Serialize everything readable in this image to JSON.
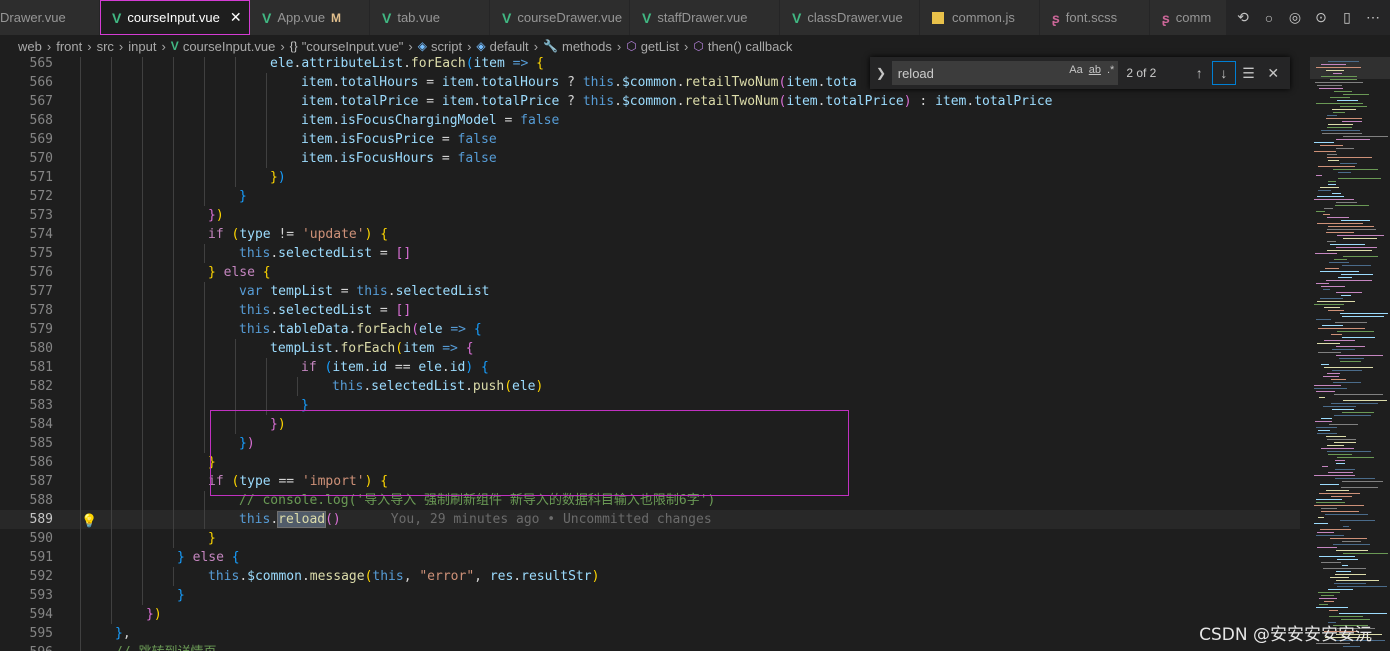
{
  "tabs": [
    {
      "label": "Drawer.vue",
      "icon": "vue-icon",
      "active": false
    },
    {
      "label": "courseInput.vue",
      "icon": "vue-icon",
      "active": true
    },
    {
      "label": "App.vue",
      "icon": "vue-icon",
      "active": false,
      "modified": "M"
    },
    {
      "label": "tab.vue",
      "icon": "vue-icon",
      "active": false
    },
    {
      "label": "courseDrawer.vue",
      "icon": "vue-icon",
      "active": false
    },
    {
      "label": "staffDrawer.vue",
      "icon": "vue-icon",
      "active": false
    },
    {
      "label": "classDrawer.vue",
      "icon": "vue-icon",
      "active": false
    },
    {
      "label": "common.js",
      "icon": "js-icon",
      "active": false
    },
    {
      "label": "font.scss",
      "icon": "sass-icon",
      "active": false
    },
    {
      "label": "comm",
      "icon": "sass-icon",
      "active": false
    }
  ],
  "tab_close": "✕",
  "breadcrumb": {
    "items": [
      "web",
      "front",
      "src",
      "input",
      "courseInput.vue",
      "\"courseInput.vue\"",
      "script",
      "default",
      "methods",
      "getList",
      "then() callback"
    ],
    "icons": [
      "",
      "",
      "",
      "",
      "vue-icon",
      "braces-icon",
      "symbol-icon",
      "symbol-icon",
      "wrench-icon",
      "method-icon",
      "method-icon"
    ]
  },
  "find": {
    "query": "reload",
    "match_case": "Aa",
    "whole_word": "ab",
    "regex": ".*",
    "count": "2 of 2"
  },
  "current_line": 589,
  "blame": "You, 29 minutes ago • Uncommitted changes",
  "code_lines": [
    {
      "n": 565,
      "indent": 6,
      "html": "<span class='t-var'>ele</span>.<span class='t-var'>attributeList</span>.<span class='t-fn'>forEach</span><span class='t-br3'>(</span><span class='t-var'>item</span> <span class='t-this'>=&gt;</span> <span class='t-br1'>{</span>"
    },
    {
      "n": 566,
      "indent": 7,
      "html": "<span class='t-var'>item</span>.<span class='t-var'>totalHours</span> = <span class='t-var'>item</span>.<span class='t-var'>totalHours</span> ? <span class='t-this'>this</span>.<span class='t-var'>$common</span>.<span class='t-fn'>retailTwoNum</span><span class='t-br2'>(</span><span class='t-var'>item</span>.<span class='t-var'>tota</span>"
    },
    {
      "n": 567,
      "indent": 7,
      "html": "<span class='t-var'>item</span>.<span class='t-var'>totalPrice</span> = <span class='t-var'>item</span>.<span class='t-var'>totalPrice</span> ? <span class='t-this'>this</span>.<span class='t-var'>$common</span>.<span class='t-fn'>retailTwoNum</span><span class='t-br2'>(</span><span class='t-var'>item</span>.<span class='t-var'>totalPrice</span><span class='t-br2'>)</span> : <span class='t-var'>item</span>.<span class='t-var'>totalPrice</span>"
    },
    {
      "n": 568,
      "indent": 7,
      "html": "<span class='t-var'>item</span>.<span class='t-var'>isFocusChargingModel</span> = <span class='t-this'>false</span>"
    },
    {
      "n": 569,
      "indent": 7,
      "html": "<span class='t-var'>item</span>.<span class='t-var'>isFocusPrice</span> = <span class='t-this'>false</span>"
    },
    {
      "n": 570,
      "indent": 7,
      "html": "<span class='t-var'>item</span>.<span class='t-var'>isFocusHours</span> = <span class='t-this'>false</span>"
    },
    {
      "n": 571,
      "indent": 6,
      "html": "<span class='t-br1'>}</span><span class='t-br3'>)</span>"
    },
    {
      "n": 572,
      "indent": 5,
      "html": "<span class='t-br3'>}</span>"
    },
    {
      "n": 573,
      "indent": 4,
      "html": "<span class='t-br2'>}</span><span class='t-br1'>)</span>"
    },
    {
      "n": 574,
      "indent": 4,
      "html": "<span class='t-kw'>if</span> <span class='t-br1'>(</span><span class='t-var'>type</span> != <span class='t-str'>'update'</span><span class='t-br1'>)</span> <span class='t-br1'>{</span>"
    },
    {
      "n": 575,
      "indent": 5,
      "html": "<span class='t-this'>this</span>.<span class='t-var'>selectedList</span> = <span class='t-br2'>[]</span>"
    },
    {
      "n": 576,
      "indent": 4,
      "html": "<span class='t-br1'>}</span> <span class='t-kw'>else</span> <span class='t-br1'>{</span>"
    },
    {
      "n": 577,
      "indent": 5,
      "html": "<span class='t-this'>var</span> <span class='t-var'>tempList</span> = <span class='t-this'>this</span>.<span class='t-var'>selectedList</span>"
    },
    {
      "n": 578,
      "indent": 5,
      "html": "<span class='t-this'>this</span>.<span class='t-var'>selectedList</span> = <span class='t-br2'>[]</span>"
    },
    {
      "n": 579,
      "indent": 5,
      "html": "<span class='t-this'>this</span>.<span class='t-var'>tableData</span>.<span class='t-fn'>forEach</span><span class='t-br2'>(</span><span class='t-var'>ele</span> <span class='t-this'>=&gt;</span> <span class='t-br3'>{</span>"
    },
    {
      "n": 580,
      "indent": 6,
      "html": "<span class='t-var'>tempList</span>.<span class='t-fn'>forEach</span><span class='t-br1'>(</span><span class='t-var'>item</span> <span class='t-this'>=&gt;</span> <span class='t-br2'>{</span>"
    },
    {
      "n": 581,
      "indent": 7,
      "html": "<span class='t-kw'>if</span> <span class='t-br3'>(</span><span class='t-var'>item</span>.<span class='t-var'>id</span> == <span class='t-var'>ele</span>.<span class='t-var'>id</span><span class='t-br3'>)</span> <span class='t-br3'>{</span>"
    },
    {
      "n": 582,
      "indent": 8,
      "html": "<span class='t-this'>this</span>.<span class='t-var'>selectedList</span>.<span class='t-fn'>push</span><span class='t-br1'>(</span><span class='t-var'>ele</span><span class='t-br1'>)</span>"
    },
    {
      "n": 583,
      "indent": 7,
      "html": "<span class='t-br3'>}</span>"
    },
    {
      "n": 584,
      "indent": 6,
      "html": "<span class='t-br2'>}</span><span class='t-br1'>)</span>"
    },
    {
      "n": 585,
      "indent": 5,
      "html": "<span class='t-br3'>}</span><span class='t-br2'>)</span>"
    },
    {
      "n": 586,
      "indent": 4,
      "html": "<span class='t-br1'>}</span>"
    },
    {
      "n": 587,
      "indent": 4,
      "html": "<span class='t-kw'>if</span> <span class='t-br1'>(</span><span class='t-var'>type</span> == <span class='t-str'>'import'</span><span class='t-br1'>)</span> <span class='t-br1'>{</span>"
    },
    {
      "n": 588,
      "indent": 5,
      "html": "<span class='t-cmt'>// console.log('导入导入 强制刷新组件 新导入的数据科目输入也限制6字')</span>"
    },
    {
      "n": 589,
      "indent": 5,
      "html": "<span class='t-this'>this</span>.<span class='t-fn match'>reload</span><span class='t-br2'>()</span>"
    },
    {
      "n": 590,
      "indent": 4,
      "html": "<span class='t-br1'>}</span>"
    },
    {
      "n": 591,
      "indent": 3,
      "html": "<span class='t-br3'>}</span> <span class='t-kw'>else</span> <span class='t-br3'>{</span>"
    },
    {
      "n": 592,
      "indent": 4,
      "html": "<span class='t-this'>this</span>.<span class='t-var'>$common</span>.<span class='t-fn'>message</span><span class='t-br1'>(</span><span class='t-this'>this</span>, <span class='t-str'>\"error\"</span>, <span class='t-var'>res</span>.<span class='t-var'>resultStr</span><span class='t-br1'>)</span>"
    },
    {
      "n": 593,
      "indent": 3,
      "html": "<span class='t-br3'>}</span>"
    },
    {
      "n": 594,
      "indent": 2,
      "html": "<span class='t-br2'>}</span><span class='t-br1'>)</span>"
    },
    {
      "n": 595,
      "indent": 1,
      "html": "<span class='t-br3'>}</span>,"
    },
    {
      "n": 596,
      "indent": 1,
      "html": "<span class='t-cmt'>// 跳转到详情页</span>"
    }
  ],
  "watermark": "CSDN @安安安安安沅"
}
